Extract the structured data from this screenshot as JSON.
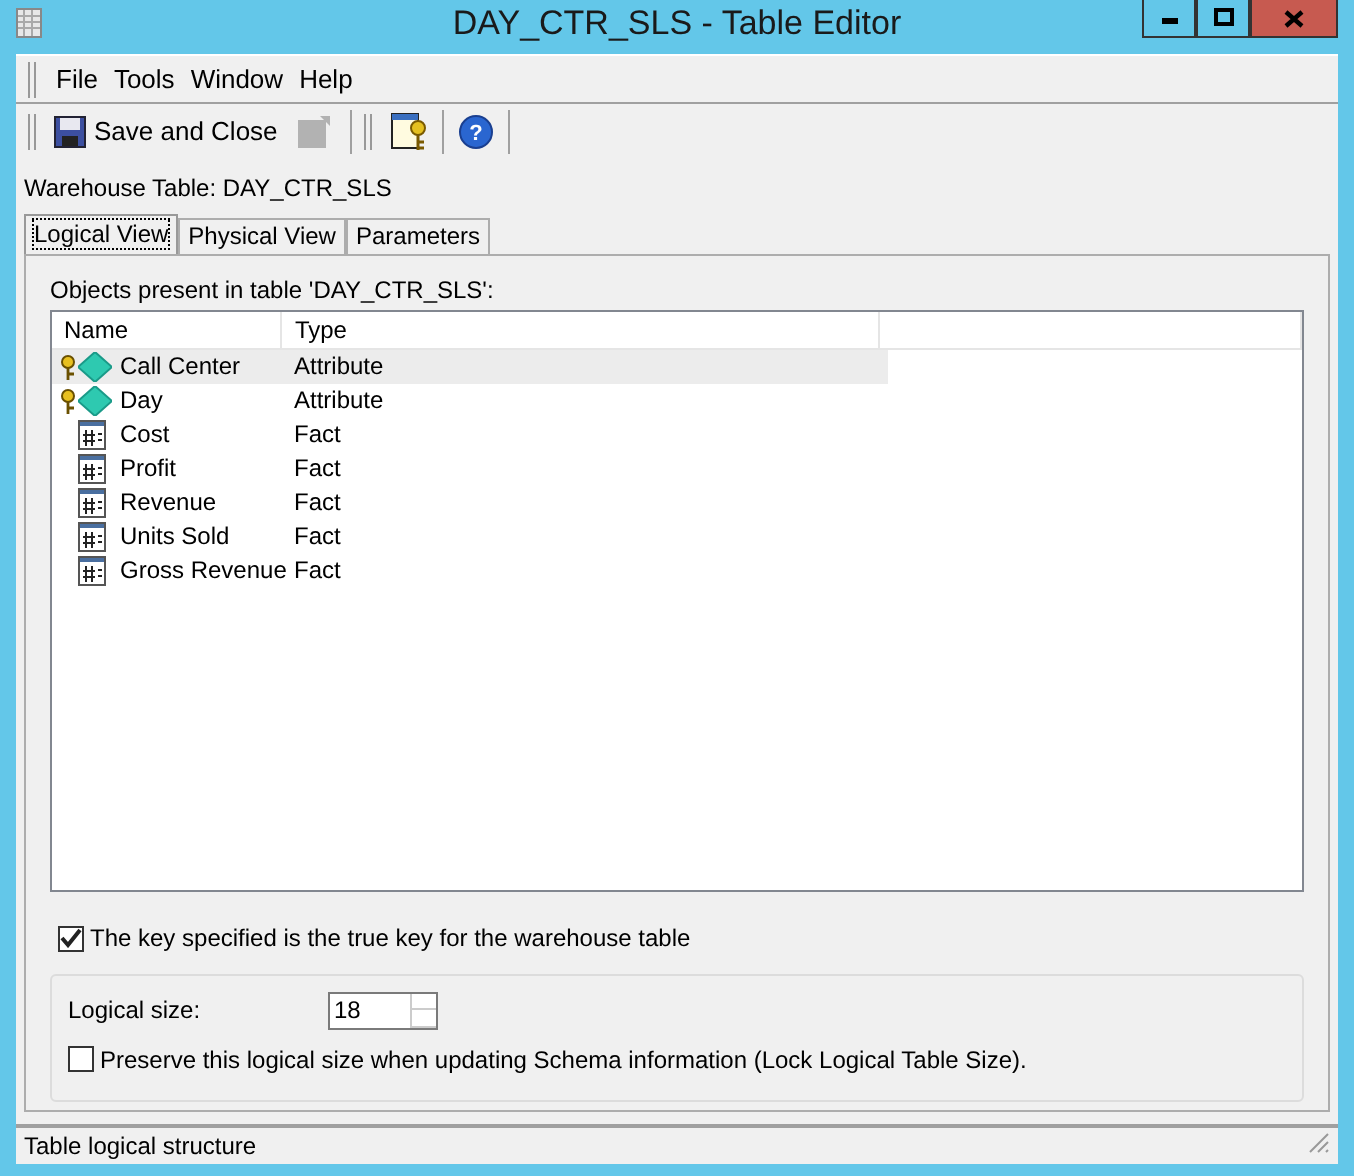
{
  "window": {
    "title": "DAY_CTR_SLS - Table Editor"
  },
  "menu": [
    "File",
    "Tools",
    "Window",
    "Help"
  ],
  "toolbar": {
    "save_label": "Save and Close",
    "save_as_disabled": true,
    "help_glyph": "?"
  },
  "warehouse_label": "Warehouse Table: DAY_CTR_SLS",
  "tabs": [
    {
      "label": "Logical View",
      "selected": true
    },
    {
      "label": "Physical View",
      "selected": false
    },
    {
      "label": "Parameters",
      "selected": false
    }
  ],
  "objects_label": "Objects present in table 'DAY_CTR_SLS':",
  "table": {
    "columns": [
      "Name",
      "Type"
    ],
    "rows": [
      {
        "name": "Call Center",
        "type": "Attribute",
        "kind": "attribute",
        "key": true,
        "selected": true
      },
      {
        "name": "Day",
        "type": "Attribute",
        "kind": "attribute",
        "key": true,
        "selected": false
      },
      {
        "name": "Cost",
        "type": "Fact",
        "kind": "fact",
        "key": false,
        "selected": false
      },
      {
        "name": "Profit",
        "type": "Fact",
        "kind": "fact",
        "key": false,
        "selected": false
      },
      {
        "name": "Revenue",
        "type": "Fact",
        "kind": "fact",
        "key": false,
        "selected": false
      },
      {
        "name": "Units Sold",
        "type": "Fact",
        "kind": "fact",
        "key": false,
        "selected": false
      },
      {
        "name": "Gross Revenue",
        "type": "Fact",
        "kind": "fact",
        "key": false,
        "selected": false
      }
    ]
  },
  "true_key": {
    "label": "The key specified is the true key for the warehouse table",
    "checked": true
  },
  "logical_size": {
    "label": "Logical size:",
    "value": "18"
  },
  "preserve": {
    "label": "Preserve this logical size when updating Schema information (Lock Logical Table Size).",
    "checked": false
  },
  "status_bar": "Table logical structure"
}
